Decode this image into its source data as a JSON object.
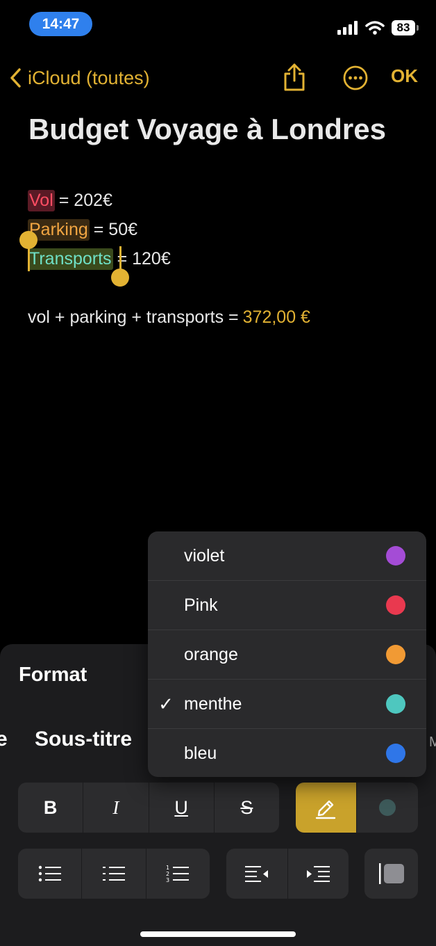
{
  "status": {
    "time": "14:47",
    "battery": "83"
  },
  "nav": {
    "back_label": "iCloud (toutes)",
    "ok_label": "OK"
  },
  "note": {
    "title": "Budget Voyage à Londres",
    "lines": [
      {
        "word": "Vol",
        "rest": "= 202€",
        "highlight": "#5a1a25",
        "word_color": "#ff4d63"
      },
      {
        "word": "Parking",
        "rest": "= 50€",
        "highlight": "#3a2a12",
        "word_color": "#f1a542"
      },
      {
        "word": "Transports",
        "rest": "= 120€",
        "highlight": "#3a4a1c",
        "word_color": "#6fe0c6"
      }
    ],
    "sum": {
      "expression": "vol + parking + transports =",
      "result": "372,00 €"
    }
  },
  "format_panel": {
    "title": "Format",
    "styles": [
      "e",
      "Sous-titre",
      "M"
    ],
    "buttons": {
      "bold": "B",
      "italic": "I",
      "underline": "U",
      "strike": "S"
    },
    "accent": "#c9a22b",
    "color_dot": "#3d5a5a"
  },
  "color_menu": {
    "items": [
      {
        "label": "violet",
        "color": "#a44cd6",
        "checked": false
      },
      {
        "label": "Pink",
        "color": "#e9394f",
        "checked": false
      },
      {
        "label": "orange",
        "color": "#f19a34",
        "checked": false
      },
      {
        "label": "menthe",
        "color": "#4ec7bf",
        "checked": true
      },
      {
        "label": "bleu",
        "color": "#2f76e8",
        "checked": false
      }
    ],
    "check_symbol": "✓"
  }
}
